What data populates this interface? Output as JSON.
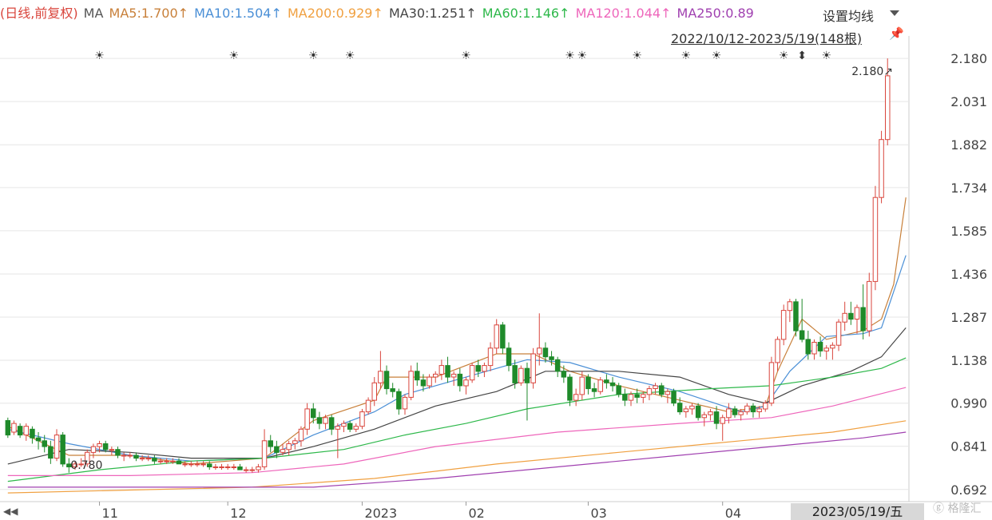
{
  "legend": {
    "period": "(日线,前复权)",
    "ma_label": "MA",
    "items": [
      {
        "text": "MA5:1.700↑",
        "color": "#c8803a"
      },
      {
        "text": "MA10:1.504↑",
        "color": "#4a8fd6"
      },
      {
        "text": "MA200:0.929↑",
        "color": "#f0a040"
      },
      {
        "text": "MA30:1.251↑",
        "color": "#444444"
      },
      {
        "text": "MA60:1.146↑",
        "color": "#2db84a"
      },
      {
        "text": "MA120:1.044↑",
        "color": "#ee66bb"
      },
      {
        "text": "MA250:0.89",
        "color": "#a040b0"
      }
    ]
  },
  "settings_label": "设置均线",
  "range_label": "2022/10/12-2023/5/19(148根)",
  "current_date": "2023/05/19/五",
  "watermark": "格隆汇",
  "colors": {
    "up": "#d9453c",
    "down": "#1f8a2a",
    "grid": "#e6e6e6",
    "axis_text": "#444444"
  },
  "chart_data": {
    "type": "candlestick",
    "x_range": [
      "2022-10-12",
      "2023-05-19"
    ],
    "bar_count": 148,
    "y_ticks": [
      2.18,
      2.031,
      1.882,
      1.734,
      1.585,
      1.436,
      1.287,
      1.138,
      0.99,
      0.841,
      0.692
    ],
    "ylim": [
      0.65,
      2.23
    ],
    "x_labels": [
      "11",
      "12",
      "2023",
      "02",
      "03",
      "04"
    ],
    "high_annotation": "2.180↗",
    "low_annotation": "0.780",
    "event_markers": 15,
    "candles_ohlc": [
      [
        0.93,
        0.94,
        0.87,
        0.88
      ],
      [
        0.89,
        0.93,
        0.88,
        0.92
      ],
      [
        0.91,
        0.92,
        0.87,
        0.88
      ],
      [
        0.88,
        0.92,
        0.86,
        0.91
      ],
      [
        0.9,
        0.91,
        0.85,
        0.87
      ],
      [
        0.87,
        0.89,
        0.83,
        0.86
      ],
      [
        0.86,
        0.88,
        0.82,
        0.84
      ],
      [
        0.84,
        0.86,
        0.78,
        0.8
      ],
      [
        0.8,
        0.9,
        0.79,
        0.88
      ],
      [
        0.88,
        0.89,
        0.77,
        0.78
      ],
      [
        0.78,
        0.8,
        0.75,
        0.77
      ],
      [
        0.77,
        0.79,
        0.76,
        0.78
      ],
      [
        0.78,
        0.8,
        0.77,
        0.78
      ],
      [
        0.78,
        0.83,
        0.77,
        0.82
      ],
      [
        0.82,
        0.85,
        0.8,
        0.84
      ],
      [
        0.84,
        0.86,
        0.82,
        0.85
      ],
      [
        0.85,
        0.86,
        0.82,
        0.83
      ],
      [
        0.83,
        0.84,
        0.81,
        0.83
      ],
      [
        0.83,
        0.84,
        0.8,
        0.81
      ],
      [
        0.81,
        0.82,
        0.79,
        0.81
      ],
      [
        0.81,
        0.82,
        0.8,
        0.81
      ],
      [
        0.81,
        0.82,
        0.79,
        0.8
      ],
      [
        0.8,
        0.81,
        0.79,
        0.8
      ],
      [
        0.8,
        0.81,
        0.79,
        0.8
      ],
      [
        0.8,
        0.81,
        0.78,
        0.79
      ],
      [
        0.79,
        0.8,
        0.78,
        0.79
      ],
      [
        0.79,
        0.8,
        0.78,
        0.79
      ],
      [
        0.79,
        0.8,
        0.78,
        0.79
      ],
      [
        0.79,
        0.8,
        0.78,
        0.78
      ],
      [
        0.78,
        0.79,
        0.77,
        0.78
      ],
      [
        0.78,
        0.79,
        0.77,
        0.78
      ],
      [
        0.78,
        0.79,
        0.77,
        0.78
      ],
      [
        0.78,
        0.79,
        0.77,
        0.78
      ],
      [
        0.78,
        0.79,
        0.76,
        0.77
      ],
      [
        0.77,
        0.78,
        0.76,
        0.77
      ],
      [
        0.77,
        0.78,
        0.76,
        0.77
      ],
      [
        0.77,
        0.78,
        0.76,
        0.77
      ],
      [
        0.77,
        0.78,
        0.76,
        0.77
      ],
      [
        0.77,
        0.78,
        0.76,
        0.76
      ],
      [
        0.76,
        0.77,
        0.75,
        0.76
      ],
      [
        0.76,
        0.77,
        0.75,
        0.76
      ],
      [
        0.76,
        0.78,
        0.75,
        0.77
      ],
      [
        0.77,
        0.9,
        0.76,
        0.86
      ],
      [
        0.86,
        0.88,
        0.82,
        0.84
      ],
      [
        0.84,
        0.86,
        0.8,
        0.82
      ],
      [
        0.82,
        0.85,
        0.81,
        0.83
      ],
      [
        0.83,
        0.86,
        0.81,
        0.85
      ],
      [
        0.85,
        0.87,
        0.83,
        0.86
      ],
      [
        0.86,
        0.91,
        0.84,
        0.9
      ],
      [
        0.9,
        0.99,
        0.88,
        0.97
      ],
      [
        0.97,
        0.99,
        0.92,
        0.94
      ],
      [
        0.94,
        0.96,
        0.9,
        0.92
      ],
      [
        0.92,
        0.95,
        0.9,
        0.94
      ],
      [
        0.94,
        0.95,
        0.88,
        0.9
      ],
      [
        0.9,
        0.92,
        0.8,
        0.91
      ],
      [
        0.91,
        0.93,
        0.89,
        0.92
      ],
      [
        0.92,
        0.93,
        0.89,
        0.9
      ],
      [
        0.9,
        0.92,
        0.89,
        0.91
      ],
      [
        0.91,
        0.97,
        0.9,
        0.96
      ],
      [
        0.96,
        1.01,
        0.95,
        1.0
      ],
      [
        1.0,
        1.08,
        0.98,
        1.06
      ],
      [
        1.06,
        1.17,
        1.04,
        1.1
      ],
      [
        1.1,
        1.12,
        1.02,
        1.04
      ],
      [
        1.04,
        1.06,
        1.01,
        1.03
      ],
      [
        1.03,
        1.04,
        0.95,
        0.97
      ],
      [
        0.97,
        1.02,
        0.95,
        1.01
      ],
      [
        1.01,
        1.12,
        1.0,
        1.1
      ],
      [
        1.1,
        1.13,
        1.05,
        1.07
      ],
      [
        1.07,
        1.09,
        1.03,
        1.05
      ],
      [
        1.05,
        1.09,
        1.04,
        1.08
      ],
      [
        1.08,
        1.1,
        1.06,
        1.09
      ],
      [
        1.09,
        1.14,
        1.07,
        1.12
      ],
      [
        1.12,
        1.15,
        1.06,
        1.08
      ],
      [
        1.08,
        1.1,
        1.05,
        1.09
      ],
      [
        1.09,
        1.11,
        1.03,
        1.05
      ],
      [
        1.05,
        1.08,
        1.02,
        1.07
      ],
      [
        1.07,
        1.13,
        1.06,
        1.12
      ],
      [
        1.12,
        1.14,
        1.08,
        1.1
      ],
      [
        1.1,
        1.13,
        1.08,
        1.12
      ],
      [
        1.12,
        1.2,
        1.1,
        1.18
      ],
      [
        1.18,
        1.28,
        1.16,
        1.26
      ],
      [
        1.26,
        1.27,
        1.16,
        1.18
      ],
      [
        1.18,
        1.2,
        1.1,
        1.12
      ],
      [
        1.12,
        1.14,
        1.04,
        1.06
      ],
      [
        1.06,
        1.12,
        1.05,
        1.11
      ],
      [
        1.11,
        1.13,
        0.93,
        1.06
      ],
      [
        1.06,
        1.18,
        1.04,
        1.16
      ],
      [
        1.16,
        1.3,
        1.12,
        1.18
      ],
      [
        1.18,
        1.2,
        1.13,
        1.15
      ],
      [
        1.15,
        1.17,
        1.12,
        1.14
      ],
      [
        1.14,
        1.15,
        1.08,
        1.1
      ],
      [
        1.1,
        1.12,
        1.06,
        1.08
      ],
      [
        1.08,
        1.09,
        0.98,
        1.0
      ],
      [
        1.0,
        1.04,
        0.98,
        1.02
      ],
      [
        1.02,
        1.1,
        1.0,
        1.08
      ],
      [
        1.08,
        1.09,
        1.02,
        1.04
      ],
      [
        1.04,
        1.06,
        1.01,
        1.03
      ],
      [
        1.03,
        1.08,
        1.02,
        1.07
      ],
      [
        1.07,
        1.09,
        1.04,
        1.06
      ],
      [
        1.06,
        1.08,
        1.03,
        1.05
      ],
      [
        1.05,
        1.06,
        1.01,
        1.02
      ],
      [
        1.02,
        1.04,
        0.98,
        1.0
      ],
      [
        1.0,
        1.03,
        0.98,
        1.02
      ],
      [
        1.02,
        1.04,
        0.99,
        1.01
      ],
      [
        1.01,
        1.03,
        0.99,
        1.02
      ],
      [
        1.02,
        1.05,
        1.0,
        1.04
      ],
      [
        1.04,
        1.06,
        1.02,
        1.05
      ],
      [
        1.05,
        1.06,
        1.01,
        1.02
      ],
      [
        1.02,
        1.04,
        0.99,
        1.03
      ],
      [
        1.03,
        1.04,
        0.98,
        0.99
      ],
      [
        0.99,
        1.01,
        0.95,
        0.96
      ],
      [
        0.96,
        0.98,
        0.94,
        0.97
      ],
      [
        0.97,
        0.99,
        0.95,
        0.98
      ],
      [
        0.98,
        0.99,
        0.93,
        0.94
      ],
      [
        0.94,
        0.96,
        0.91,
        0.95
      ],
      [
        0.95,
        0.97,
        0.93,
        0.96
      ],
      [
        0.96,
        0.98,
        0.9,
        0.92
      ],
      [
        0.92,
        0.95,
        0.86,
        0.94
      ],
      [
        0.94,
        0.99,
        0.92,
        0.97
      ],
      [
        0.97,
        0.98,
        0.94,
        0.95
      ],
      [
        0.95,
        0.97,
        0.93,
        0.96
      ],
      [
        0.96,
        0.99,
        0.95,
        0.98
      ],
      [
        0.98,
        0.99,
        0.94,
        0.96
      ],
      [
        0.96,
        0.98,
        0.94,
        0.97
      ],
      [
        0.97,
        1.0,
        0.96,
        0.99
      ],
      [
        0.99,
        1.15,
        0.98,
        1.13
      ],
      [
        1.13,
        1.22,
        1.1,
        1.21
      ],
      [
        1.21,
        1.33,
        1.19,
        1.31
      ],
      [
        1.31,
        1.35,
        1.27,
        1.34
      ],
      [
        1.34,
        1.35,
        1.22,
        1.24
      ],
      [
        1.24,
        1.35,
        1.2,
        1.21
      ],
      [
        1.21,
        1.24,
        1.14,
        1.16
      ],
      [
        1.16,
        1.21,
        1.14,
        1.2
      ],
      [
        1.2,
        1.22,
        1.15,
        1.17
      ],
      [
        1.17,
        1.19,
        1.14,
        1.18
      ],
      [
        1.18,
        1.2,
        1.14,
        1.19
      ],
      [
        1.19,
        1.28,
        1.17,
        1.27
      ],
      [
        1.27,
        1.34,
        1.24,
        1.3
      ],
      [
        1.3,
        1.34,
        1.26,
        1.28
      ],
      [
        1.28,
        1.33,
        1.23,
        1.32
      ],
      [
        1.32,
        1.4,
        1.21,
        1.24
      ],
      [
        1.24,
        1.44,
        1.22,
        1.41
      ],
      [
        1.41,
        1.74,
        1.38,
        1.7
      ],
      [
        1.7,
        1.93,
        1.68,
        1.9
      ],
      [
        1.9,
        2.18,
        1.88,
        2.12
      ]
    ],
    "ma_lines": {
      "MA5": {
        "end": 1.7,
        "points": [
          [
            0,
            0.91
          ],
          [
            10,
            0.81
          ],
          [
            20,
            0.81
          ],
          [
            30,
            0.78
          ],
          [
            42,
            0.8
          ],
          [
            50,
            0.93
          ],
          [
            60,
            1.0
          ],
          [
            62,
            1.08
          ],
          [
            70,
            1.08
          ],
          [
            80,
            1.16
          ],
          [
            86,
            1.16
          ],
          [
            92,
            1.1
          ],
          [
            100,
            1.05
          ],
          [
            110,
            1.0
          ],
          [
            118,
            0.96
          ],
          [
            124,
            0.98
          ],
          [
            126,
            1.1
          ],
          [
            130,
            1.28
          ],
          [
            134,
            1.21
          ],
          [
            140,
            1.24
          ],
          [
            143,
            1.28
          ],
          [
            145,
            1.4
          ],
          [
            147,
            1.7
          ]
        ]
      },
      "MA10": {
        "end": 1.504,
        "points": [
          [
            0,
            0.9
          ],
          [
            10,
            0.85
          ],
          [
            20,
            0.81
          ],
          [
            30,
            0.79
          ],
          [
            42,
            0.8
          ],
          [
            50,
            0.88
          ],
          [
            60,
            0.96
          ],
          [
            65,
            1.02
          ],
          [
            75,
            1.08
          ],
          [
            85,
            1.14
          ],
          [
            92,
            1.13
          ],
          [
            100,
            1.08
          ],
          [
            110,
            1.03
          ],
          [
            120,
            0.96
          ],
          [
            124,
            0.98
          ],
          [
            128,
            1.1
          ],
          [
            134,
            1.22
          ],
          [
            140,
            1.23
          ],
          [
            143,
            1.25
          ],
          [
            147,
            1.5
          ]
        ]
      },
      "MA30": {
        "end": 1.251,
        "points": [
          [
            0,
            0.78
          ],
          [
            10,
            0.83
          ],
          [
            20,
            0.82
          ],
          [
            30,
            0.8
          ],
          [
            42,
            0.8
          ],
          [
            50,
            0.84
          ],
          [
            60,
            0.9
          ],
          [
            70,
            0.98
          ],
          [
            80,
            1.03
          ],
          [
            88,
            1.1
          ],
          [
            100,
            1.1
          ],
          [
            110,
            1.08
          ],
          [
            118,
            1.02
          ],
          [
            124,
            0.99
          ],
          [
            130,
            1.05
          ],
          [
            138,
            1.1
          ],
          [
            143,
            1.15
          ],
          [
            147,
            1.25
          ]
        ]
      },
      "MA60": {
        "end": 1.146,
        "points": [
          [
            0,
            0.72
          ],
          [
            15,
            0.76
          ],
          [
            30,
            0.79
          ],
          [
            42,
            0.8
          ],
          [
            55,
            0.83
          ],
          [
            65,
            0.88
          ],
          [
            75,
            0.92
          ],
          [
            85,
            0.97
          ],
          [
            100,
            1.02
          ],
          [
            115,
            1.04
          ],
          [
            125,
            1.05
          ],
          [
            135,
            1.08
          ],
          [
            143,
            1.11
          ],
          [
            147,
            1.146
          ]
        ]
      },
      "MA120": {
        "end": 1.044,
        "points": [
          [
            0,
            0.74
          ],
          [
            20,
            0.74
          ],
          [
            40,
            0.75
          ],
          [
            55,
            0.78
          ],
          [
            70,
            0.84
          ],
          [
            90,
            0.89
          ],
          [
            110,
            0.92
          ],
          [
            125,
            0.94
          ],
          [
            135,
            0.98
          ],
          [
            147,
            1.044
          ]
        ]
      },
      "MA200": {
        "end": 0.929,
        "points": [
          [
            0,
            0.68
          ],
          [
            20,
            0.69
          ],
          [
            40,
            0.7
          ],
          [
            60,
            0.73
          ],
          [
            80,
            0.78
          ],
          [
            100,
            0.82
          ],
          [
            120,
            0.86
          ],
          [
            135,
            0.89
          ],
          [
            147,
            0.929
          ]
        ]
      },
      "MA250": {
        "end": 0.89,
        "points": [
          [
            0,
            0.7
          ],
          [
            30,
            0.7
          ],
          [
            50,
            0.7
          ],
          [
            70,
            0.73
          ],
          [
            90,
            0.77
          ],
          [
            110,
            0.81
          ],
          [
            125,
            0.84
          ],
          [
            140,
            0.87
          ],
          [
            147,
            0.89
          ]
        ]
      }
    }
  }
}
